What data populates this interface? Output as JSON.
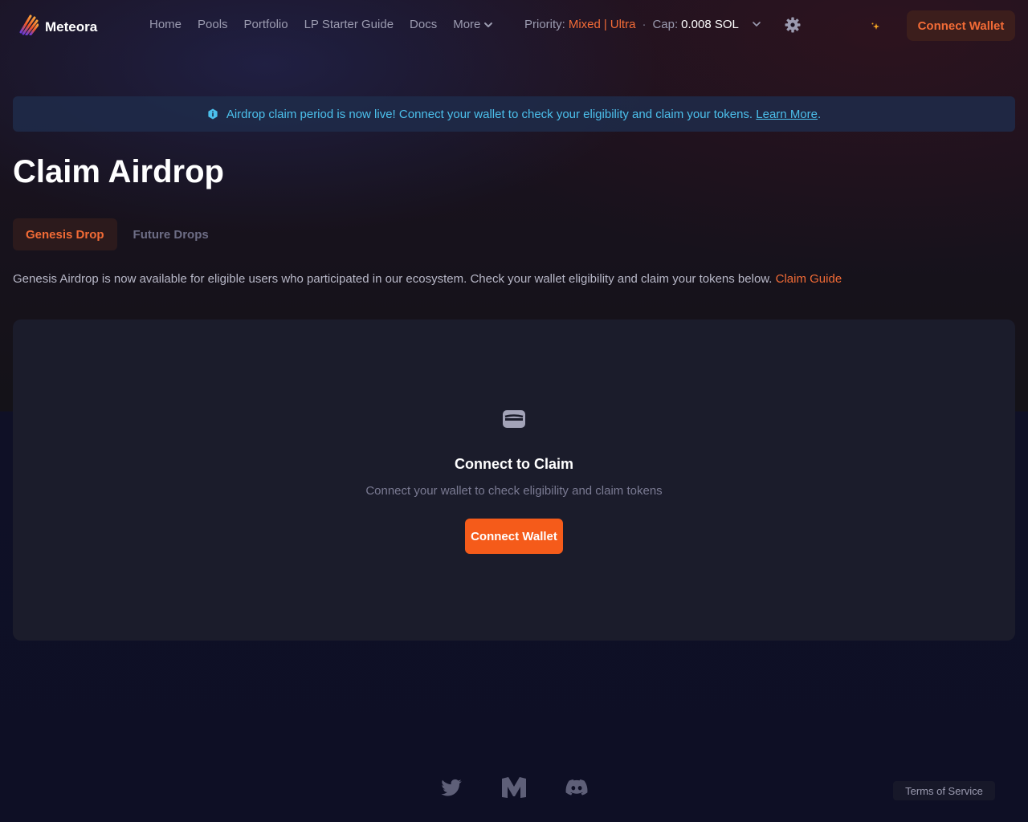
{
  "header": {
    "logo_text": "Meteora",
    "nav": {
      "home": "Home",
      "pools": "Pools",
      "portfolio": "Portfolio",
      "lp_guide": "LP Starter Guide",
      "docs": "Docs",
      "more": "More"
    },
    "priority": {
      "label": "Priority:",
      "mode": "Mixed",
      "separator": "|",
      "engine": "Ultra",
      "dot": "·",
      "cap_label": "Cap:",
      "cap_value": "0.008 SOL"
    },
    "connect_label": "Connect Wallet"
  },
  "banner": {
    "text": "Airdrop claim period is now live! Connect your wallet to check your eligibility and claim your tokens.",
    "link": "Learn More",
    "period": "."
  },
  "page": {
    "title": "Claim Airdrop",
    "tabs": [
      "Genesis Drop",
      "Future Drops"
    ],
    "active_tab": "Genesis Drop",
    "description": "Genesis Airdrop is now available for eligible users who participated in our ecosystem. Check your wallet eligibility and claim your tokens below.",
    "guide_link": "Claim Guide"
  },
  "card": {
    "title": "Connect to Claim",
    "subtitle": "Connect your wallet to check eligibility and claim tokens",
    "button": "Connect Wallet"
  },
  "footer": {
    "icons": [
      "twitter-icon",
      "medium-icon",
      "discord-icon"
    ],
    "terms": "Terms of Service"
  },
  "colors": {
    "accent": "#f26b36",
    "primary_button": "#f55b1a",
    "banner_text": "#4cc0ec"
  }
}
